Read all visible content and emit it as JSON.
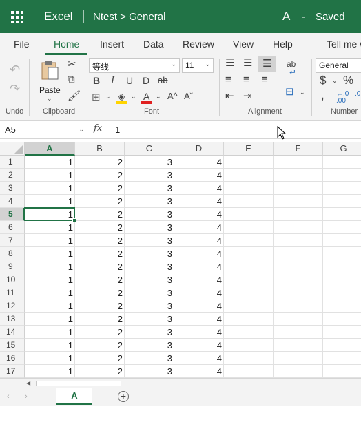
{
  "titlebar": {
    "app_name": "Excel",
    "breadcrumb": "Ntest > General",
    "user_initial": "A",
    "separator": "-",
    "save_status": "Saved",
    "accent_color": "#217346"
  },
  "menu_tabs": [
    "File",
    "Home",
    "Insert",
    "Data",
    "Review",
    "View",
    "Help",
    "Tell me w"
  ],
  "active_tab": "Home",
  "ribbon": {
    "groups": {
      "undo": "Undo",
      "clipboard": "Clipboard",
      "font": "Font",
      "alignment": "Alignment",
      "number": "Number"
    },
    "paste_label": "Paste",
    "font_name": "等线",
    "font_size": "11",
    "number_format": "General",
    "buttons": {
      "bold": "B",
      "italic": "I",
      "underline": "U",
      "double_underline": "D",
      "strikethrough": "ab",
      "font_color": "A",
      "grow_font": "A^",
      "shrink_font": "Aˇ",
      "wrap_text": "ab",
      "currency": "$",
      "percent": "%"
    }
  },
  "formula_bar": {
    "name_box": "A5",
    "fx_label": "fx",
    "value": "1"
  },
  "grid": {
    "columns": [
      "A",
      "B",
      "C",
      "D",
      "E",
      "F",
      "G"
    ],
    "selected_column": "A",
    "selected_row": "5",
    "rows": [
      {
        "row": "1",
        "cells": [
          "1",
          "2",
          "3",
          "4",
          "",
          "",
          ""
        ]
      },
      {
        "row": "2",
        "cells": [
          "1",
          "2",
          "3",
          "4",
          "",
          "",
          ""
        ]
      },
      {
        "row": "3",
        "cells": [
          "1",
          "2",
          "3",
          "4",
          "",
          "",
          ""
        ]
      },
      {
        "row": "4",
        "cells": [
          "1",
          "2",
          "3",
          "4",
          "",
          "",
          ""
        ]
      },
      {
        "row": "5",
        "cells": [
          "1",
          "2",
          "3",
          "4",
          "",
          "",
          ""
        ]
      },
      {
        "row": "6",
        "cells": [
          "1",
          "2",
          "3",
          "4",
          "",
          "",
          ""
        ]
      },
      {
        "row": "7",
        "cells": [
          "1",
          "2",
          "3",
          "4",
          "",
          "",
          ""
        ]
      },
      {
        "row": "8",
        "cells": [
          "1",
          "2",
          "3",
          "4",
          "",
          "",
          ""
        ]
      },
      {
        "row": "9",
        "cells": [
          "1",
          "2",
          "3",
          "4",
          "",
          "",
          ""
        ]
      },
      {
        "row": "10",
        "cells": [
          "1",
          "2",
          "3",
          "4",
          "",
          "",
          ""
        ]
      },
      {
        "row": "11",
        "cells": [
          "1",
          "2",
          "3",
          "4",
          "",
          "",
          ""
        ]
      },
      {
        "row": "12",
        "cells": [
          "1",
          "2",
          "3",
          "4",
          "",
          "",
          ""
        ]
      },
      {
        "row": "13",
        "cells": [
          "1",
          "2",
          "3",
          "4",
          "",
          "",
          ""
        ]
      },
      {
        "row": "14",
        "cells": [
          "1",
          "2",
          "3",
          "4",
          "",
          "",
          ""
        ]
      },
      {
        "row": "15",
        "cells": [
          "1",
          "2",
          "3",
          "4",
          "",
          "",
          ""
        ]
      },
      {
        "row": "16",
        "cells": [
          "1",
          "2",
          "3",
          "4",
          "",
          "",
          ""
        ]
      },
      {
        "row": "17",
        "cells": [
          "1",
          "2",
          "3",
          "4",
          "",
          "",
          ""
        ]
      }
    ]
  },
  "sheets": {
    "tabs": [
      "A"
    ],
    "active": "A"
  }
}
